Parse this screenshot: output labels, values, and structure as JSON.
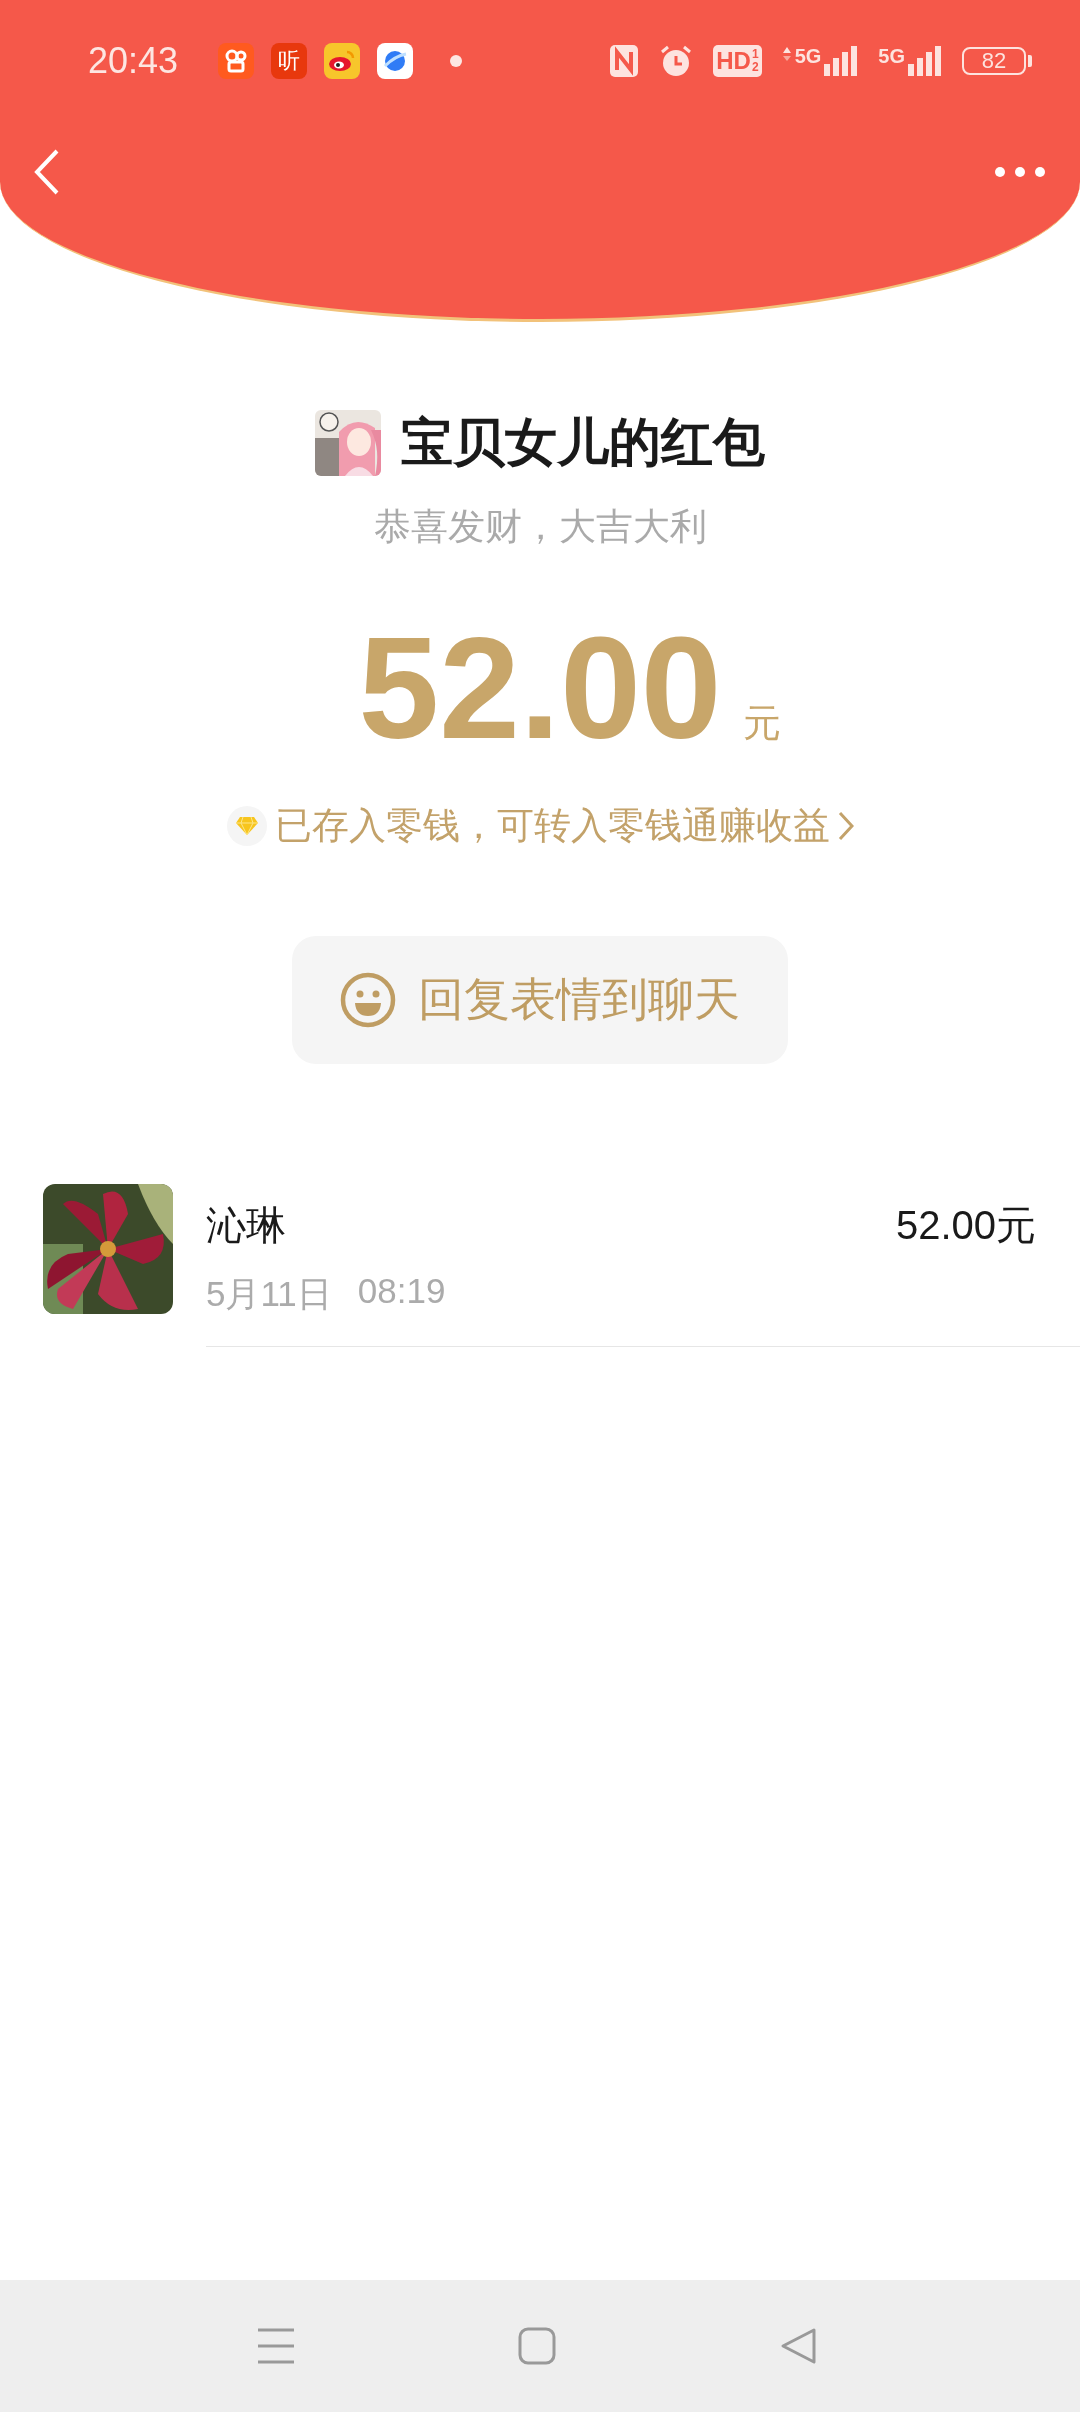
{
  "status_bar": {
    "time": "20:43",
    "notifications": [
      {
        "kind": "video"
      },
      {
        "kind": "listen",
        "label": "听"
      },
      {
        "kind": "weibo"
      },
      {
        "kind": "browser"
      }
    ],
    "hd": {
      "label": "HD",
      "marks": [
        "1",
        "2"
      ]
    },
    "signals": [
      {
        "label": "5G",
        "data_activity": true
      },
      {
        "label": "5G",
        "data_activity": false
      }
    ],
    "battery": "82"
  },
  "red_packet": {
    "title": "宝贝女儿的红包",
    "greeting": "恭喜发财，大吉大利",
    "amount": "52.00",
    "currency": "元",
    "notice": "已存入零钱，可转入零钱通赚收益",
    "reply_button": "回复表情到聊天"
  },
  "receivers": [
    {
      "name": "沁琳",
      "date": "5月11日",
      "time": "08:19",
      "amount": "52.00元"
    }
  ]
}
